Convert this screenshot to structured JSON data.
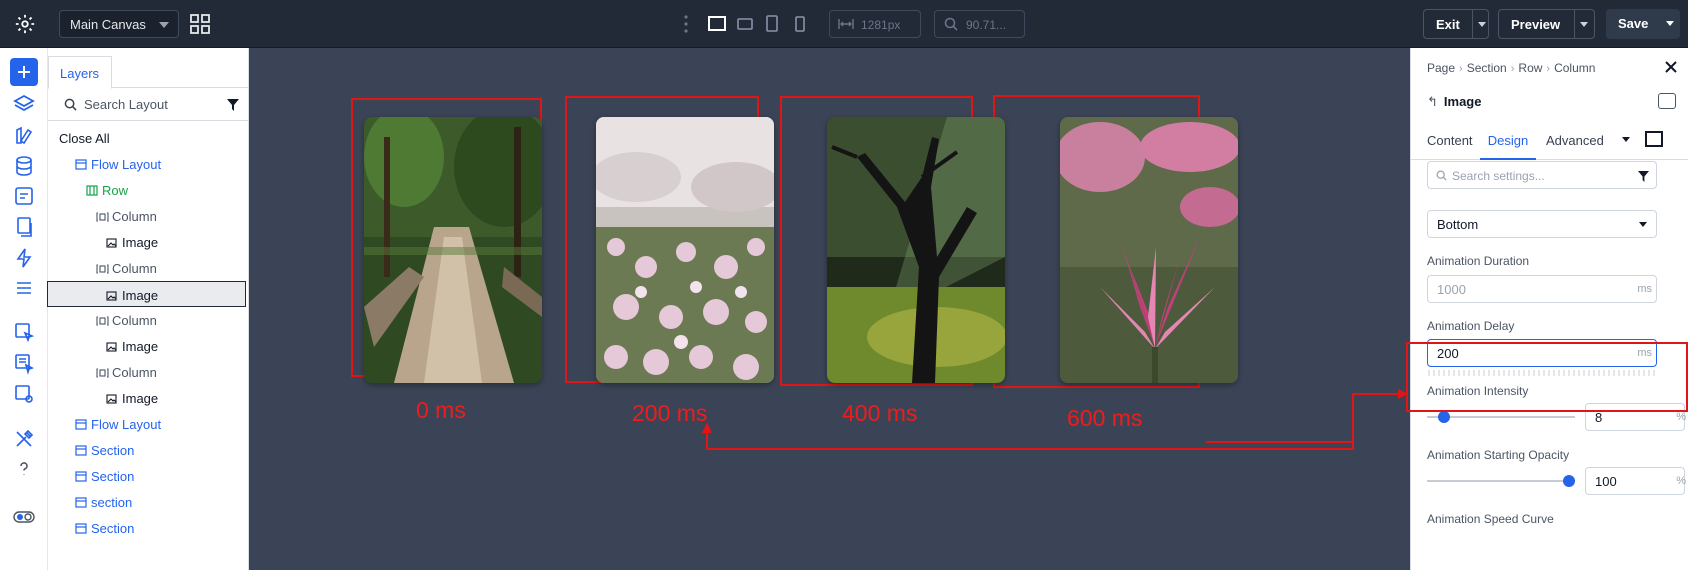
{
  "topbar": {
    "canvas_select": "Main Canvas",
    "width_value": "1281px",
    "zoom_value": "90.71...",
    "exit_label": "Exit",
    "preview_label": "Preview",
    "save_label": "Save"
  },
  "layers": {
    "tab_label": "Layers",
    "search_placeholder": "Search Layout",
    "close_all": "Close All",
    "tree": [
      {
        "label": "Flow Layout",
        "type": "flow-layout",
        "depth": 1
      },
      {
        "label": "Row",
        "type": "row",
        "depth": 2
      },
      {
        "label": "Column",
        "type": "column",
        "depth": 3
      },
      {
        "label": "Image",
        "type": "image",
        "depth": 4
      },
      {
        "label": "Column",
        "type": "column",
        "depth": 3
      },
      {
        "label": "Image",
        "type": "image",
        "depth": 4,
        "selected": true
      },
      {
        "label": "Column",
        "type": "column",
        "depth": 3
      },
      {
        "label": "Image",
        "type": "image",
        "depth": 4
      },
      {
        "label": "Column",
        "type": "column",
        "depth": 3
      },
      {
        "label": "Image",
        "type": "image",
        "depth": 4
      },
      {
        "label": "Flow Layout",
        "type": "flow-layout",
        "depth": 1
      },
      {
        "label": "Section",
        "type": "section",
        "depth": 1
      },
      {
        "label": "Section",
        "type": "section",
        "depth": 1
      },
      {
        "label": "section",
        "type": "section",
        "depth": 1
      },
      {
        "label": "Section",
        "type": "section",
        "depth": 1
      }
    ]
  },
  "canvas": {
    "cards": [
      {
        "delay_label": "0 ms",
        "scene": "forest-path"
      },
      {
        "delay_label": "200 ms",
        "scene": "pink-flower-field"
      },
      {
        "delay_label": "400 ms",
        "scene": "sunlit-tree"
      },
      {
        "delay_label": "600 ms",
        "scene": "magnolia"
      }
    ]
  },
  "settings": {
    "breadcrumb": [
      "Page",
      "Section",
      "Row",
      "Column"
    ],
    "element_title": "Image",
    "tabs": [
      "Content",
      "Design",
      "Advanced"
    ],
    "active_tab": "Design",
    "search_placeholder": "Search settings...",
    "direction_value": "Bottom",
    "duration": {
      "label": "Animation Duration",
      "placeholder": "1000",
      "unit": "ms"
    },
    "delay": {
      "label": "Animation Delay",
      "value": "200",
      "unit": "ms"
    },
    "intensity": {
      "label": "Animation Intensity",
      "value": "8",
      "unit": "%",
      "fraction": 0.08
    },
    "opacity": {
      "label": "Animation Starting Opacity",
      "value": "100",
      "unit": "%",
      "fraction": 1.0
    },
    "speed_curve": {
      "label": "Animation Speed Curve"
    }
  },
  "colors": {
    "accent": "#2563eb",
    "annotation_red": "#e01515",
    "canvas_bg": "#3b4456",
    "topbar_bg": "#222a37"
  }
}
